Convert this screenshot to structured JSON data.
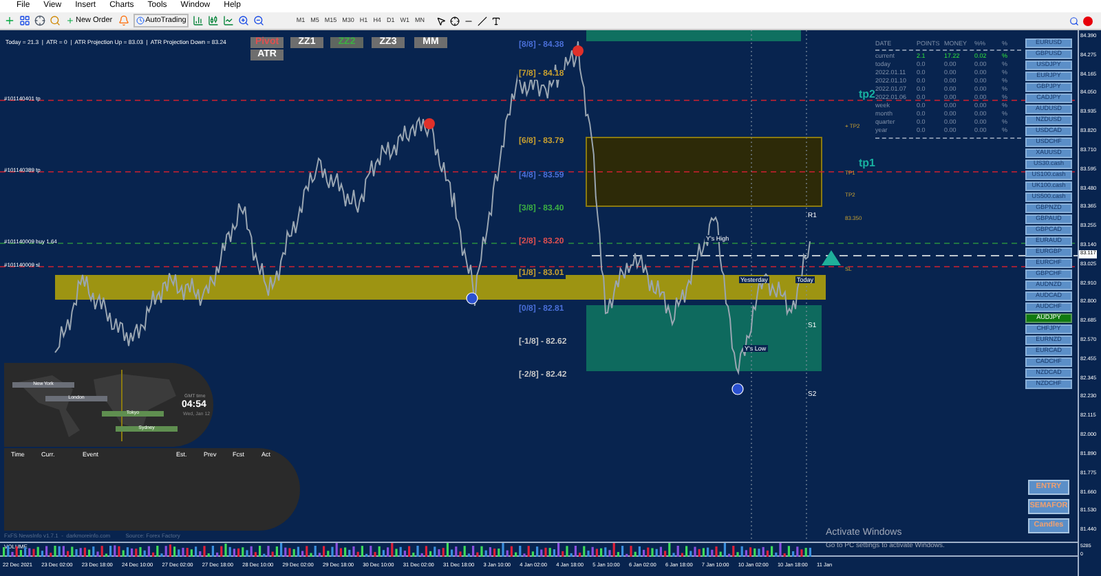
{
  "menu": [
    "File",
    "View",
    "Insert",
    "Charts",
    "Tools",
    "Window",
    "Help"
  ],
  "toolbar": {
    "new_order": "New Order",
    "autotrading": "AutoTrading",
    "timeframes": [
      "M1",
      "M5",
      "M15",
      "M30",
      "H1",
      "H4",
      "D1",
      "W1",
      "MN"
    ]
  },
  "info_line": "Today = 21.3  |  ATR = 0  |  ATR Projection Up = 83.03  |  ATR Projection Down = 83.24",
  "indicator_buttons": [
    {
      "label": "Pivot",
      "on": false,
      "alert": true
    },
    {
      "label": "ATR",
      "on": false,
      "alert": false
    },
    {
      "label": "ZZ1",
      "on": false,
      "alert": false
    },
    {
      "label": "ZZ2",
      "on": true,
      "alert": false
    },
    {
      "label": "ZZ3",
      "on": false,
      "alert": false
    },
    {
      "label": "MM",
      "on": false,
      "alert": false
    }
  ],
  "levels": [
    {
      "label": "[8/8] - 84.38",
      "color": "#4a6fd8"
    },
    {
      "label": "[7/8] - 84.18",
      "color": "#c8a030"
    },
    {
      "label": "[6/8] - 83.79",
      "color": "#c8a030"
    },
    {
      "label": "[4/8] - 83.59",
      "color": "#4a6fd8"
    },
    {
      "label": "[3/8] - 83.40",
      "color": "#3cb043"
    },
    {
      "label": "[2/8] - 83.20",
      "color": "#e05050"
    },
    {
      "label": "[1/8] - 83.01",
      "color": "#c8a030"
    },
    {
      "label": "[0/8] - 82.81",
      "color": "#4a6fd8"
    },
    {
      "label": "[-1/8] - 82.62",
      "color": "#c8c8c8"
    },
    {
      "label": "[-2/8] - 82.42",
      "color": "#c8c8c8"
    }
  ],
  "order_labels": [
    "#101140401 tp",
    "#101140389 tp",
    "#101140009 buy 1.64",
    "#101140009 sl"
  ],
  "targets": [
    "tp2",
    "tp1"
  ],
  "pivots": [
    "R1",
    "S1",
    "S2"
  ],
  "session_labels": [
    "Y's High",
    "Y's Low",
    "Yesterday",
    "Today"
  ],
  "side_labels": [
    "+ TP2",
    "TP1",
    "TP2",
    "83.350",
    "SL"
  ],
  "stats": {
    "columns": [
      "DATE",
      "POINTS",
      "MONEY",
      "%%",
      "%"
    ],
    "rows": [
      {
        "label": "current",
        "points": "2.1",
        "money": "17.22",
        "pct": "0.02",
        "unit": "%",
        "positive": true
      },
      {
        "label": "today",
        "points": "0.0",
        "money": "0.00",
        "pct": "0.00",
        "unit": "%",
        "positive": false
      },
      {
        "label": "2022.01.11",
        "points": "0.0",
        "money": "0.00",
        "pct": "0.00",
        "unit": "%",
        "positive": false
      },
      {
        "label": "2022.01.10",
        "points": "0.0",
        "money": "0.00",
        "pct": "0.00",
        "unit": "%",
        "positive": false
      },
      {
        "label": "2022.01.07",
        "points": "0.0",
        "money": "0.00",
        "pct": "0.00",
        "unit": "%",
        "positive": false
      },
      {
        "label": "2022.01.06",
        "points": "0.0",
        "money": "0.00",
        "pct": "0.00",
        "unit": "%",
        "positive": false
      },
      {
        "label": "week",
        "points": "0.0",
        "money": "0.00",
        "pct": "0.00",
        "unit": "%",
        "positive": false
      },
      {
        "label": "month",
        "points": "0.0",
        "money": "0.00",
        "pct": "0.00",
        "unit": "%",
        "positive": false
      },
      {
        "label": "quarter",
        "points": "0.0",
        "money": "0.00",
        "pct": "0.00",
        "unit": "%",
        "positive": false
      },
      {
        "label": "year",
        "points": "0.0",
        "money": "0.00",
        "pct": "0.00",
        "unit": "%",
        "positive": false
      }
    ]
  },
  "symbols": [
    {
      "label": "EURUSD",
      "selected": false
    },
    {
      "label": "GBPUSD",
      "selected": false
    },
    {
      "label": "USDJPY",
      "selected": false
    },
    {
      "label": "EURJPY",
      "selected": false
    },
    {
      "label": "GBPJPY",
      "selected": false
    },
    {
      "label": "CADJPY",
      "selected": false
    },
    {
      "label": "AUDUSD",
      "selected": false
    },
    {
      "label": "NZDUSD",
      "selected": false
    },
    {
      "label": "USDCAD",
      "selected": false
    },
    {
      "label": "USDCHF",
      "selected": false
    },
    {
      "label": "XAUUSD",
      "selected": false
    },
    {
      "label": "US30.cash",
      "selected": false
    },
    {
      "label": "US100.cash",
      "selected": false
    },
    {
      "label": "UK100.cash",
      "selected": false
    },
    {
      "label": "US500.cash",
      "selected": false
    },
    {
      "label": "GBPNZD",
      "selected": false
    },
    {
      "label": "GBPAUD",
      "selected": false
    },
    {
      "label": "GBPCAD",
      "selected": false
    },
    {
      "label": "EURAUD",
      "selected": false
    },
    {
      "label": "EURGBP",
      "selected": false
    },
    {
      "label": "EURCHF",
      "selected": false
    },
    {
      "label": "GBPCHF",
      "selected": false
    },
    {
      "label": "AUDNZD",
      "selected": false
    },
    {
      "label": "AUDCAD",
      "selected": false
    },
    {
      "label": "AUDCHF",
      "selected": false
    },
    {
      "label": "AUDJPY",
      "selected": true
    },
    {
      "label": "CHFJPY",
      "selected": false
    },
    {
      "label": "EURNZD",
      "selected": false
    },
    {
      "label": "EURCAD",
      "selected": false
    },
    {
      "label": "CADCHF",
      "selected": false
    },
    {
      "label": "NZDCAD",
      "selected": false
    },
    {
      "label": "NZDCHF",
      "selected": false
    }
  ],
  "action_buttons": [
    "ENTRY",
    "SEMAFOR",
    "Candles"
  ],
  "clock": {
    "sessions": [
      "New York",
      "London",
      "Tokyo",
      "Sydney"
    ],
    "caption": "GMT time",
    "time": "04:54",
    "date": "Wed, Jan 12"
  },
  "news": {
    "columns": [
      "Time",
      "Curr.",
      "Event",
      "Est.",
      "Prev",
      "Fcst",
      "Act"
    ],
    "footer": "FxFS NewsInfo v1.7.1  -  darkmoreinfo.com          Source: Forex Factory"
  },
  "volume_title": "VOLUME",
  "price_axis": [
    "84.390",
    "84.275",
    "84.165",
    "84.050",
    "83.935",
    "83.820",
    "83.710",
    "83.595",
    "83.480",
    "83.365",
    "83.255",
    "83.140",
    "83.025",
    "82.910",
    "82.800",
    "82.685",
    "82.570",
    "82.455",
    "82.345",
    "82.230",
    "82.115",
    "82.000",
    "81.890",
    "81.775",
    "81.660",
    "81.530",
    "81.440"
  ],
  "current_price": "83.117",
  "volume_axis": [
    "5285",
    "0"
  ],
  "time_axis": [
    "22 Dec 2021",
    "23 Dec 02:00",
    "23 Dec 18:00",
    "24 Dec 10:00",
    "27 Dec 02:00",
    "27 Dec 18:00",
    "28 Dec 10:00",
    "29 Dec 02:00",
    "29 Dec 18:00",
    "30 Dec 10:00",
    "31 Dec 02:00",
    "31 Dec 18:00",
    "3 Jan 10:00",
    "4 Jan 02:00",
    "4 Jan 18:00",
    "5 Jan 10:00",
    "6 Jan 02:00",
    "6 Jan 18:00",
    "7 Jan 10:00",
    "10 Jan 02:00",
    "10 Jan 18:00",
    "11 Jan"
  ],
  "activation": {
    "title": "Activate Windows",
    "text": "Go to PC settings to activate Windows."
  }
}
